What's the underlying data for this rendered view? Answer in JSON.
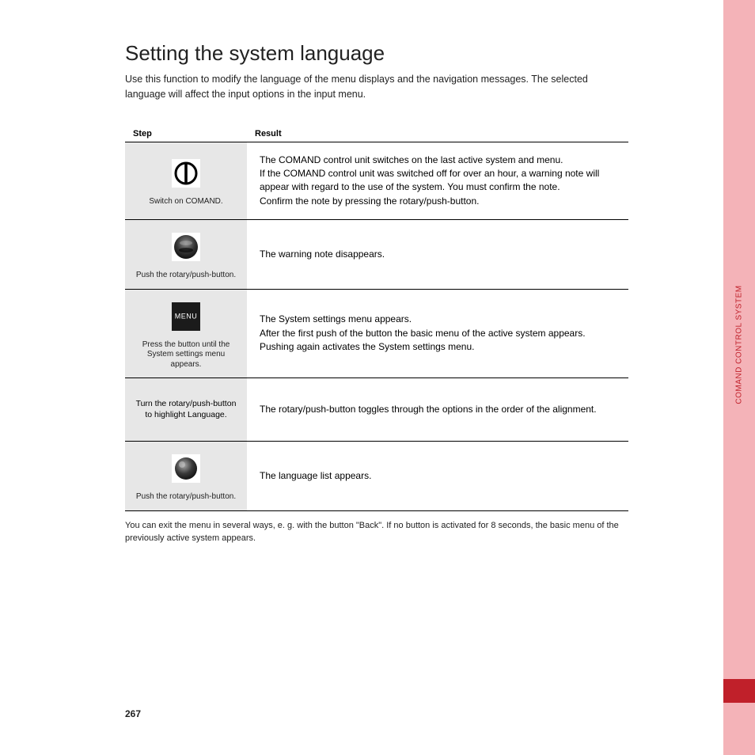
{
  "sidebar": {
    "label": "COMAND CONTROL SYSTEM",
    "marker": true
  },
  "title": "Setting the system language",
  "intro": "Use this function to modify the language of the menu displays and the navigation messages. The selected language will affect the input options in the input menu.",
  "table": {
    "headers": [
      "Step",
      "Result"
    ],
    "rows": [
      {
        "icon": "power",
        "icon_label": "Switch on COMAND.",
        "desc_heading": "",
        "desc": "The COMAND control unit switches on the last active system and menu.\nIf the COMAND control unit was switched off for over an hour, a warning note will appear with regard to the use of the system. You must confirm the note.\nConfirm the note by pressing the rotary/push-button."
      },
      {
        "icon": "push-button",
        "icon_label": "Push the rotary/push-button.",
        "desc": "The warning note disappears."
      },
      {
        "icon": "menu",
        "icon_label": "Press the button until the System settings menu appears.",
        "desc": "The System settings menu appears.\nAfter the first push of the button the basic menu of the active system appears. Pushing again activates the System settings menu."
      },
      {
        "icon": "none",
        "icon_label": "Turn the rotary/push-button to highlight Language.",
        "desc": "The rotary/push-button toggles through the options in the order of the alignment."
      },
      {
        "icon": "ball",
        "icon_label": "Push the rotary/push-button.",
        "desc": "The language list appears."
      }
    ]
  },
  "exit_note": "You can exit the menu in several ways, e. g. with the button \"Back\". If no button is activated for 8 seconds, the basic menu of the previously active system appears.",
  "page_number": "267"
}
